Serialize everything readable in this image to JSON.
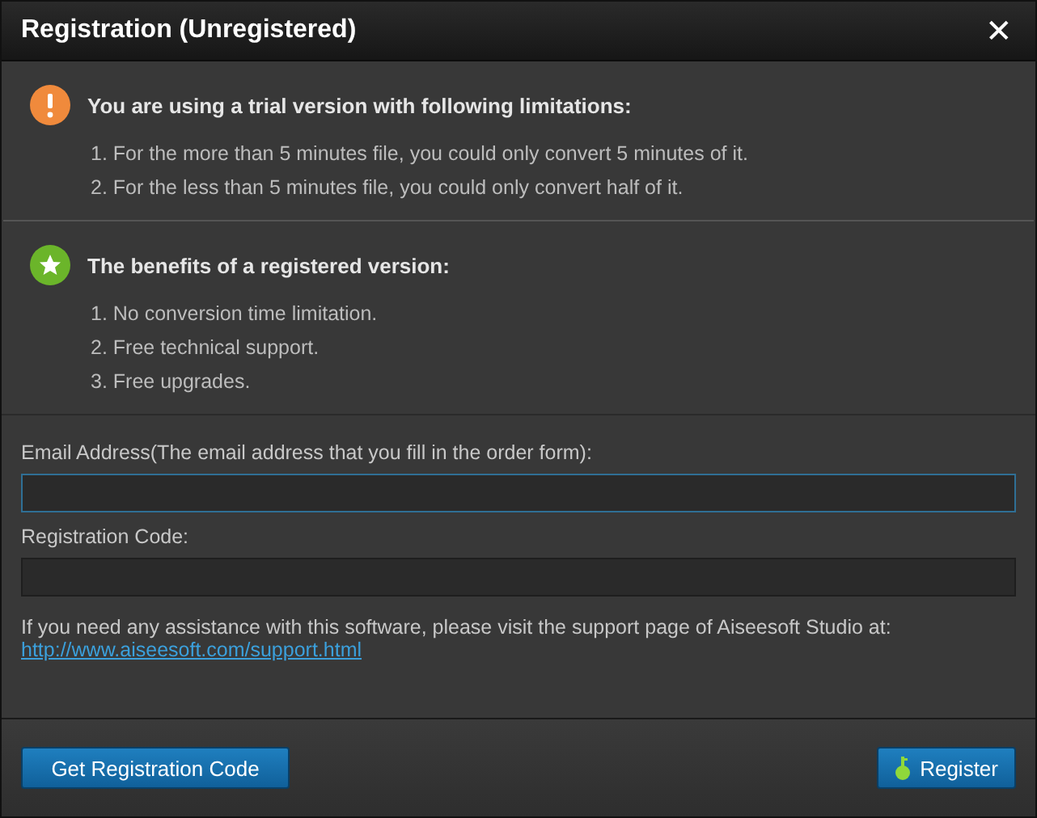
{
  "window": {
    "title": "Registration (Unregistered)",
    "close": "✕"
  },
  "limitations": {
    "heading": "You are using a trial version with following limitations:",
    "items": [
      "1. For the more than 5 minutes file, you could only convert 5 minutes of it.",
      "2. For the less than 5 minutes file, you could only convert half of it."
    ]
  },
  "benefits": {
    "heading": "The benefits of a registered version:",
    "items": [
      "1. No conversion time limitation.",
      "2. Free technical support.",
      "3. Free upgrades."
    ]
  },
  "form": {
    "fields": [
      {
        "label": "Email Address(The email address that you fill in the order form):",
        "focused": true
      },
      {
        "label": "Registration Code:",
        "focused": false
      }
    ],
    "help": "If you need any assistance with this software, please visit the support page of Aiseesoft Studio at:",
    "link": "http://www.aiseesoft.com/support.html"
  },
  "buttons": [
    {
      "label": "Get Registration Code",
      "kind": "wide"
    },
    {
      "label": "Register",
      "kind": "key"
    }
  ]
}
